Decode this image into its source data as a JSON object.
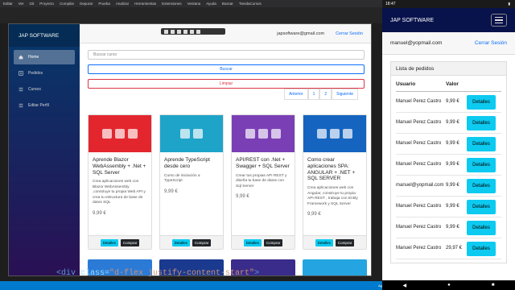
{
  "ide": {
    "menu": [
      "Editar",
      "Ver",
      "Git",
      "Proyecto",
      "Compilar",
      "Depurar",
      "Prueba",
      "Analizar",
      "Herramientas",
      "Extensiones",
      "Ventana",
      "Ayuda",
      "Buscar",
      "TiendaCursos"
    ],
    "code_tag_open": "<div",
    "code_attr": " class=",
    "code_value": "\"d-flex justify-content-start\"",
    "code_close": ">",
    "status_text": "Agregar al control de código fuente"
  },
  "app": {
    "brand": "JAP SOFTWARE",
    "sidebar": [
      {
        "label": "Home",
        "icon": "home-icon",
        "active": true
      },
      {
        "label": "Pedidos",
        "icon": "plus-icon",
        "active": false
      },
      {
        "label": "Cursos",
        "icon": "list-icon",
        "active": false
      },
      {
        "label": "Editar Perfil",
        "icon": "list-icon",
        "active": false
      }
    ],
    "user_email": "japsoftware@gmail.com",
    "logout": "Cerrar Sesión",
    "search_placeholder": "Buscar curso",
    "btn_search": "Buscar",
    "btn_clear": "Limpiar",
    "pagination": [
      "Anterior",
      "1",
      "2",
      "Siguiente"
    ],
    "courses": [
      {
        "title": "Aprende Blazor WebAssembly + .Net + SQL Server",
        "desc": "Crea aplicaciones web con Blazor WebAssembly ,construye tu propia Web API y crea tu estructura de base de datos SQL",
        "price": "9,99 €",
        "thumb_color": "#e3262e"
      },
      {
        "title": "Aprende TypeScript desde cero",
        "desc": "Curso de iniciación a TypeScript",
        "price": "9,99 €",
        "thumb_color": "#1fa4c9"
      },
      {
        "title": "API/REST con .Net + Swagger + SQL Server",
        "desc": "Crear tus propias API REST y diseña tu base de datos con Sql Server",
        "price": "9,99 €",
        "thumb_color": "#7b3fb5"
      },
      {
        "title": "Como crear aplicaciones SPA: ANGULAR + .NET + SQL SERVER",
        "desc": "Crea aplicaciones web con Angular, construye tu propia API REST , trabaja con Entity Framework y SQL Server",
        "price": "9,99 €",
        "thumb_color": "#1565c0"
      }
    ],
    "btn_details": "Detalles",
    "btn_buy": "Comprar",
    "second_row_colors": [
      "#2b7bd6",
      "#1a3a8f",
      "#3a2c8a",
      "#24a4e0"
    ]
  },
  "phone": {
    "time": "18:47",
    "brand": "JAP SOFTWARE",
    "user_email": "manuel@yopmail.com",
    "logout": "Cerrar Sesión",
    "card_title": "Lista de pedidos",
    "col_user": "Usuario",
    "col_value": "Valor",
    "btn_details": "Detalles",
    "orders": [
      {
        "user": "Manuel Perez Castro",
        "value": "9,99 €"
      },
      {
        "user": "Manuel Perez Castro",
        "value": "9,99 €"
      },
      {
        "user": "Manuel Perez Castro",
        "value": "9,99 €"
      },
      {
        "user": "Manuel Perez Castro",
        "value": "9,99 €"
      },
      {
        "user": "manuel@yopmail.com",
        "value": "9,99 €"
      },
      {
        "user": "Manuel Perez Castro",
        "value": "9,99 €"
      },
      {
        "user": "Manuel Perez Castro",
        "value": "9,99 €"
      },
      {
        "user": "Manuel Perez Castro",
        "value": "29,97 €"
      }
    ]
  }
}
